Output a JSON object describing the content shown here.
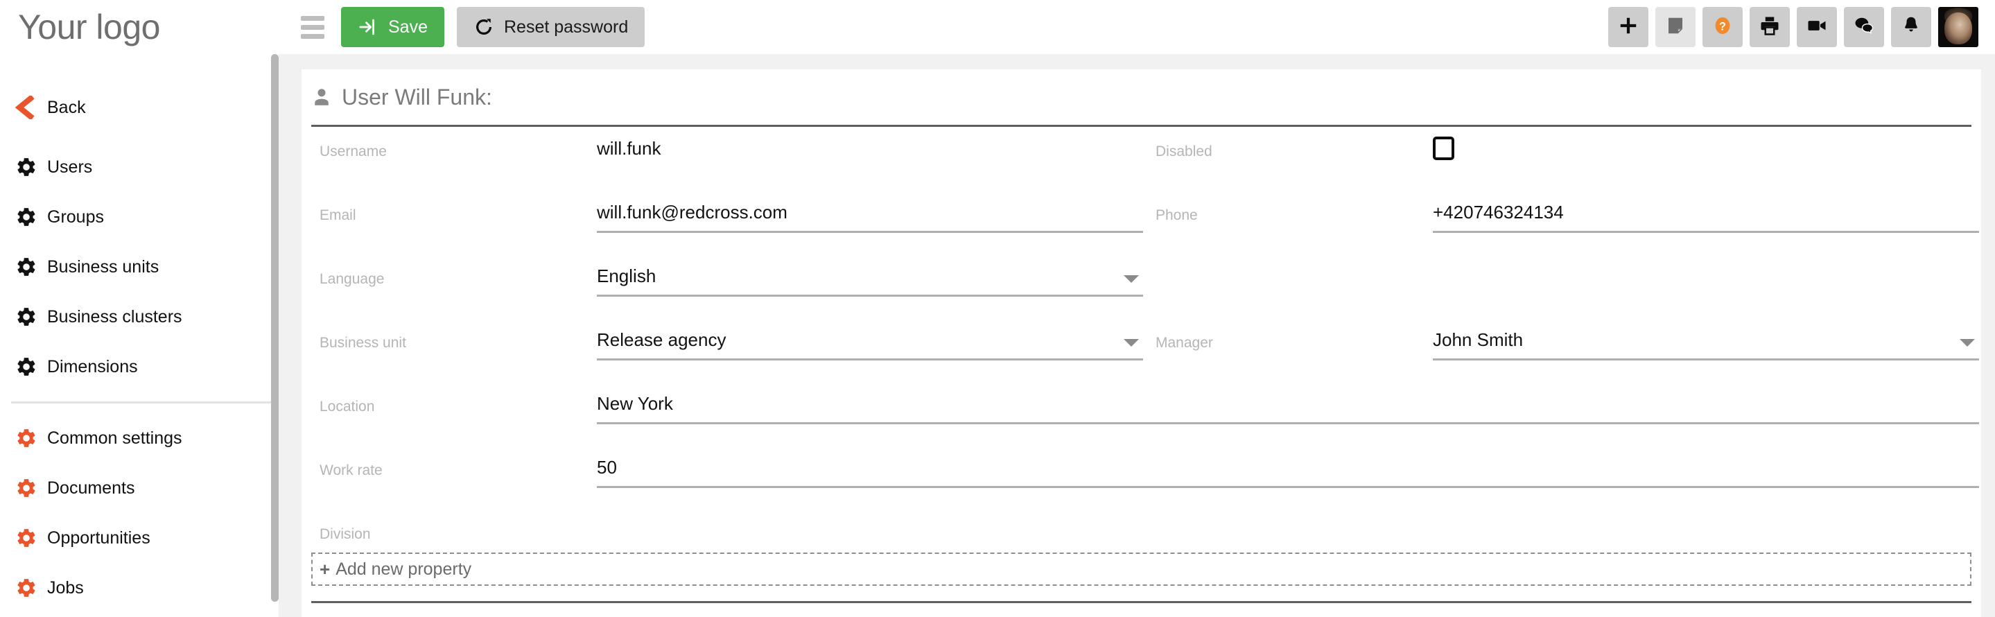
{
  "brand": {
    "logo_text": "Your logo",
    "accent_color": "#e8552a",
    "save_color": "#4caf50"
  },
  "sidebar": {
    "back": {
      "label": "Back",
      "icon": "chevron-left-icon"
    },
    "group_one": [
      {
        "label": "Users",
        "icon": "gear-icon"
      },
      {
        "label": "Groups",
        "icon": "gear-icon"
      },
      {
        "label": "Business units",
        "icon": "gear-icon"
      },
      {
        "label": "Business clusters",
        "icon": "gear-icon"
      },
      {
        "label": "Dimensions",
        "icon": "gear-icon"
      }
    ],
    "group_two": [
      {
        "label": "Common settings",
        "icon": "gear-icon"
      },
      {
        "label": "Documents",
        "icon": "gear-icon"
      },
      {
        "label": "Opportunities",
        "icon": "gear-icon"
      },
      {
        "label": "Jobs",
        "icon": "gear-icon"
      }
    ]
  },
  "toolbar": {
    "menu_icon": "hamburger-icon",
    "save_label": "Save",
    "save_icon": "sign-in-arrow-icon",
    "reset_label": "Reset password",
    "reset_icon": "refresh-icon",
    "right_icons": [
      {
        "name": "plus-icon"
      },
      {
        "name": "note-icon"
      },
      {
        "name": "help-icon"
      },
      {
        "name": "print-icon"
      },
      {
        "name": "video-camera-icon"
      },
      {
        "name": "chat-icon"
      },
      {
        "name": "bell-icon"
      },
      {
        "name": "avatar"
      }
    ]
  },
  "page": {
    "title": "User Will Funk:",
    "title_icon": "person-icon"
  },
  "form": {
    "username": {
      "label": "Username",
      "value": "will.funk"
    },
    "disabled": {
      "label": "Disabled",
      "checked": false
    },
    "email": {
      "label": "Email",
      "value": "will.funk@redcross.com"
    },
    "phone": {
      "label": "Phone",
      "value": "+420746324134"
    },
    "language": {
      "label": "Language",
      "value": "English"
    },
    "business_unit": {
      "label": "Business unit",
      "value": "Release agency"
    },
    "manager": {
      "label": "Manager",
      "value": "John Smith"
    },
    "location": {
      "label": "Location",
      "value": "New York"
    },
    "work_rate": {
      "label": "Work rate",
      "value": "50"
    },
    "division": {
      "label": "Division",
      "value": ""
    },
    "add_property": {
      "label": "Add new property",
      "icon": "plus-icon"
    }
  }
}
